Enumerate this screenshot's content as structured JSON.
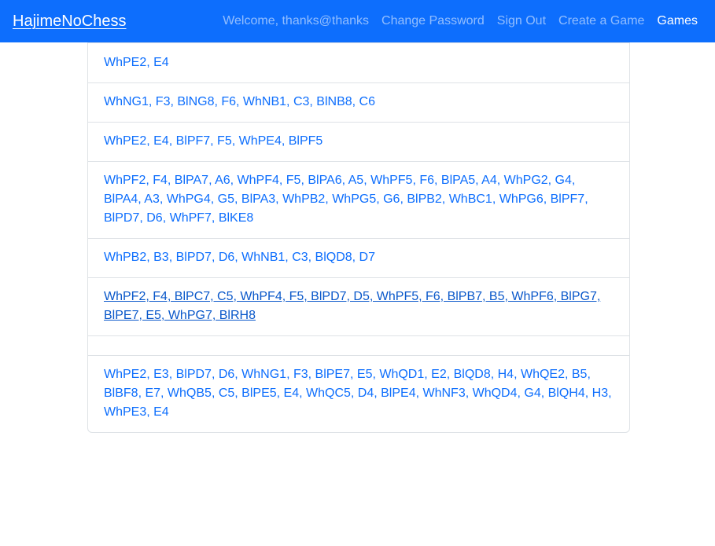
{
  "navbar": {
    "brand": "HajimeNoChess",
    "welcome": "Welcome, thanks@thanks",
    "change_password": "Change Password",
    "sign_out": "Sign Out",
    "create_game": "Create a Game",
    "games": "Games"
  },
  "games": [
    "WhPE2, E4",
    "WhNG1, F3, BlNG8, F6, WhNB1, C3, BlNB8, C6",
    "WhPE2, E4, BlPF7, F5, WhPE4, BlPF5",
    "WhPF2, F4, BlPA7, A6, WhPF4, F5, BlPA6, A5, WhPF5, F6, BlPA5, A4, WhPG2, G4, BlPA4, A3, WhPG4, G5, BlPA3, WhPB2, WhPG5, G6, BlPB2, WhBC1, WhPG6, BlPF7, BlPD7, D6, WhPF7, BlKE8",
    "WhPB2, B3, BlPD7, D6, WhNB1, C3, BlQD8, D7",
    "WhPF2, F4, BlPC7, C5, WhPF4, F5, BlPD7, D5, WhPF5, F6, BlPB7, B5, WhPF6, BlPG7, BlPE7, E5, WhPG7, BlRH8",
    "",
    "WhPE2, E3, BlPD7, D6, WhNG1, F3, BlPE7, E5, WhQD1, E2, BlQD8, H4, WhQE2, B5, BlBF8, E7, WhQB5, C5, BlPE5, E4, WhQC5, D4, BlPE4, WhNF3, WhQD4, G4, BlQH4, H3, WhPE3, E4"
  ]
}
